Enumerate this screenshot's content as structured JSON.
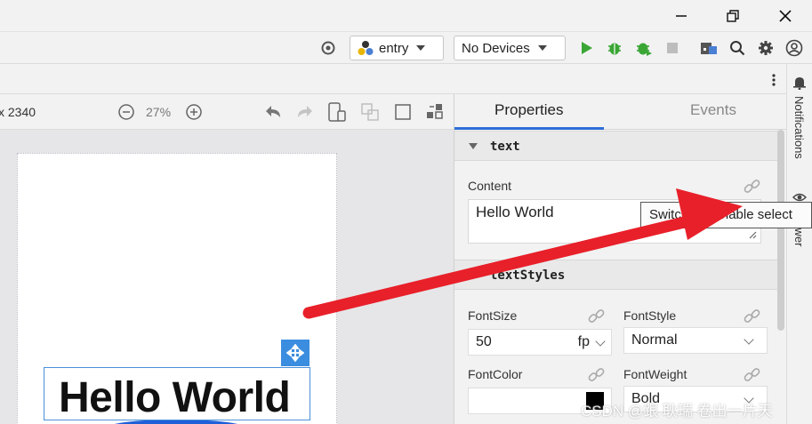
{
  "window": {
    "minimize_icon": "minimize-icon",
    "maximize_icon": "restore-icon",
    "close_icon": "close-icon"
  },
  "toolbar": {
    "module_selector": {
      "value": "entry",
      "icon": "module-icon"
    },
    "device_selector": {
      "value": "No Devices"
    },
    "run_icon": "run-icon",
    "debug_icon": "debug-icon",
    "attach_debugger_icon": "attach-debugger-icon",
    "stop_icon": "stop-icon",
    "project_structure_icon": "project-structure-icon",
    "search_icon": "search-icon",
    "settings_icon": "gear-icon",
    "account_icon": "account-icon",
    "colors": {
      "run": "#3aa635",
      "debug": "#3aa635",
      "accent": "#2e6fd8"
    }
  },
  "canvas_toolbar": {
    "resolution_text": "x 2340",
    "zoom_level": "27%",
    "zoom_out_icon": "zoom-out-icon",
    "zoom_in_icon": "zoom-in-icon"
  },
  "canvas": {
    "component_text": "Hello World"
  },
  "properties_panel": {
    "tabs": [
      {
        "label": "Properties",
        "active": true
      },
      {
        "label": "Events",
        "active": false
      }
    ],
    "sections": [
      {
        "title": "text",
        "expanded": true
      },
      {
        "title": "textStyles",
        "expanded": true
      }
    ],
    "content_label": "Content",
    "content_value": "Hello World",
    "font_size": {
      "label": "FontSize",
      "value": "50",
      "unit": "fp"
    },
    "font_style": {
      "label": "FontStyle",
      "value": "Normal"
    },
    "font_color": {
      "label": "FontColor",
      "value": "#000000"
    },
    "font_weight": {
      "label": "FontWeight",
      "value": "Bold"
    }
  },
  "tooltip": {
    "text": "Switch to variable select"
  },
  "side_bar": {
    "notifications_label": "Notifications",
    "viewer_label": "Viewer"
  },
  "watermark": "CSDN @跟 耿瑞 卷出一片天"
}
